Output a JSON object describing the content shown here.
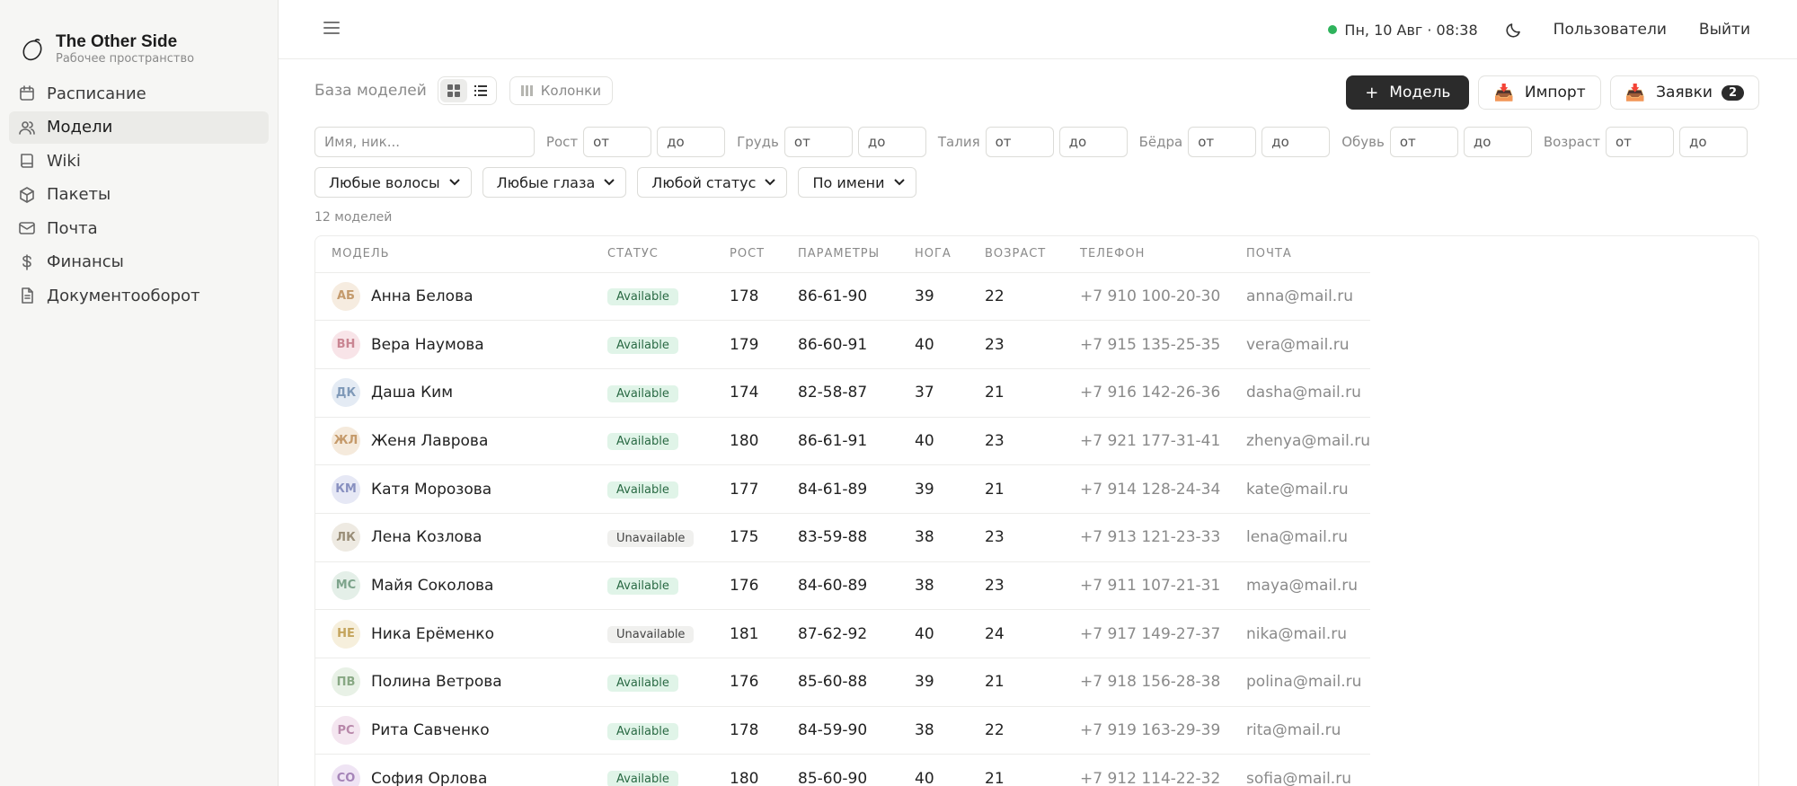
{
  "app": {
    "title": "The Other Side",
    "subtitle": "Рабочее пространство"
  },
  "sidebar": {
    "items": [
      {
        "label": "Расписание",
        "icon": "calendar-icon",
        "active": false
      },
      {
        "label": "Модели",
        "icon": "users-icon",
        "active": true
      },
      {
        "label": "Wiki",
        "icon": "book-icon",
        "active": false
      },
      {
        "label": "Пакеты",
        "icon": "package-icon",
        "active": false
      },
      {
        "label": "Почта",
        "icon": "mail-icon",
        "active": false
      },
      {
        "label": "Финансы",
        "icon": "dollar-icon",
        "active": false
      },
      {
        "label": "Документооборот",
        "icon": "document-icon",
        "active": false
      }
    ]
  },
  "topbar": {
    "datetime": "Пн, 10 Авг · 08:38",
    "users_label": "Пользователи",
    "logout_label": "Выйти"
  },
  "toolbar": {
    "title": "База моделей",
    "columns_label": "Колонки",
    "add_label": "Модель",
    "import_label": "Импорт",
    "requests_label": "Заявки",
    "requests_count": "2"
  },
  "filters": {
    "name_placeholder": "Имя, ник...",
    "from_placeholder": "от",
    "to_placeholder": "до",
    "ranges": [
      "Рост",
      "Грудь",
      "Талия",
      "Бёдра",
      "Обувь",
      "Возраст"
    ],
    "hair": "Любые волосы",
    "eyes": "Любые глаза",
    "status": "Любой статус",
    "sort": "По имени"
  },
  "count_label": "12 моделей",
  "table": {
    "headers": [
      "МОДЕЛЬ",
      "СТАТУС",
      "РОСТ",
      "ПАРАМЕТРЫ",
      "НОГА",
      "ВОЗРАСТ",
      "ТЕЛЕФОН",
      "ПОЧТА"
    ],
    "rows": [
      {
        "initials": "АБ",
        "name": "Анна Белова",
        "status": "Available",
        "height": "178",
        "params": "86-61-90",
        "foot": "39",
        "age": "22",
        "phone": "+7 910 100-20-30",
        "email": "anna@mail.ru",
        "avatar_bg": "#f6ece0",
        "avatar_fg": "#c49a6c"
      },
      {
        "initials": "ВН",
        "name": "Вера Наумова",
        "status": "Available",
        "height": "179",
        "params": "86-60-91",
        "foot": "40",
        "age": "23",
        "phone": "+7 915 135-25-35",
        "email": "vera@mail.ru",
        "avatar_bg": "#f8e4e8",
        "avatar_fg": "#c98592"
      },
      {
        "initials": "ДК",
        "name": "Даша Ким",
        "status": "Available",
        "height": "174",
        "params": "82-58-87",
        "foot": "37",
        "age": "21",
        "phone": "+7 916 142-26-36",
        "email": "dasha@mail.ru",
        "avatar_bg": "#e4ebf4",
        "avatar_fg": "#7f99b8"
      },
      {
        "initials": "ЖЛ",
        "name": "Женя Лаврова",
        "status": "Available",
        "height": "180",
        "params": "86-61-91",
        "foot": "40",
        "age": "23",
        "phone": "+7 921 177-31-41",
        "email": "zhenya@mail.ru",
        "avatar_bg": "#f5eadc",
        "avatar_fg": "#c59a6a"
      },
      {
        "initials": "КМ",
        "name": "Катя Морозова",
        "status": "Available",
        "height": "177",
        "params": "84-61-89",
        "foot": "39",
        "age": "21",
        "phone": "+7 914 128-24-34",
        "email": "kate@mail.ru",
        "avatar_bg": "#e6e8f5",
        "avatar_fg": "#8890c0"
      },
      {
        "initials": "ЛК",
        "name": "Лена Козлова",
        "status": "Unavailable",
        "height": "175",
        "params": "83-59-88",
        "foot": "38",
        "age": "23",
        "phone": "+7 913 121-23-33",
        "email": "lena@mail.ru",
        "avatar_bg": "#eeeae2",
        "avatar_fg": "#9a8e78"
      },
      {
        "initials": "МС",
        "name": "Майя Соколова",
        "status": "Available",
        "height": "176",
        "params": "84-60-89",
        "foot": "38",
        "age": "23",
        "phone": "+7 911 107-21-31",
        "email": "maya@mail.ru",
        "avatar_bg": "#e4efe8",
        "avatar_fg": "#7ea48c"
      },
      {
        "initials": "НЕ",
        "name": "Ника Ерёменко",
        "status": "Unavailable",
        "height": "181",
        "params": "87-62-92",
        "foot": "40",
        "age": "24",
        "phone": "+7 917 149-27-37",
        "email": "nika@mail.ru",
        "avatar_bg": "#f6efdc",
        "avatar_fg": "#c4a45c"
      },
      {
        "initials": "ПВ",
        "name": "Полина Ветрова",
        "status": "Available",
        "height": "176",
        "params": "85-60-88",
        "foot": "39",
        "age": "21",
        "phone": "+7 918 156-28-38",
        "email": "polina@mail.ru",
        "avatar_bg": "#e8f1e6",
        "avatar_fg": "#88a884"
      },
      {
        "initials": "РС",
        "name": "Рита Савченко",
        "status": "Available",
        "height": "178",
        "params": "84-59-90",
        "foot": "38",
        "age": "22",
        "phone": "+7 919 163-29-39",
        "email": "rita@mail.ru",
        "avatar_bg": "#f4e6f0",
        "avatar_fg": "#b888aa"
      },
      {
        "initials": "СО",
        "name": "София Орлова",
        "status": "Available",
        "height": "180",
        "params": "85-60-90",
        "foot": "40",
        "age": "21",
        "phone": "+7 912 114-22-32",
        "email": "sofia@mail.ru",
        "avatar_bg": "#efe4f4",
        "avatar_fg": "#a584b8"
      }
    ]
  },
  "colors": {
    "accent": "#2b2b2b",
    "online": "#2fb35c",
    "available_bg": "#e0f4e8",
    "available_fg": "#2a6a44"
  }
}
